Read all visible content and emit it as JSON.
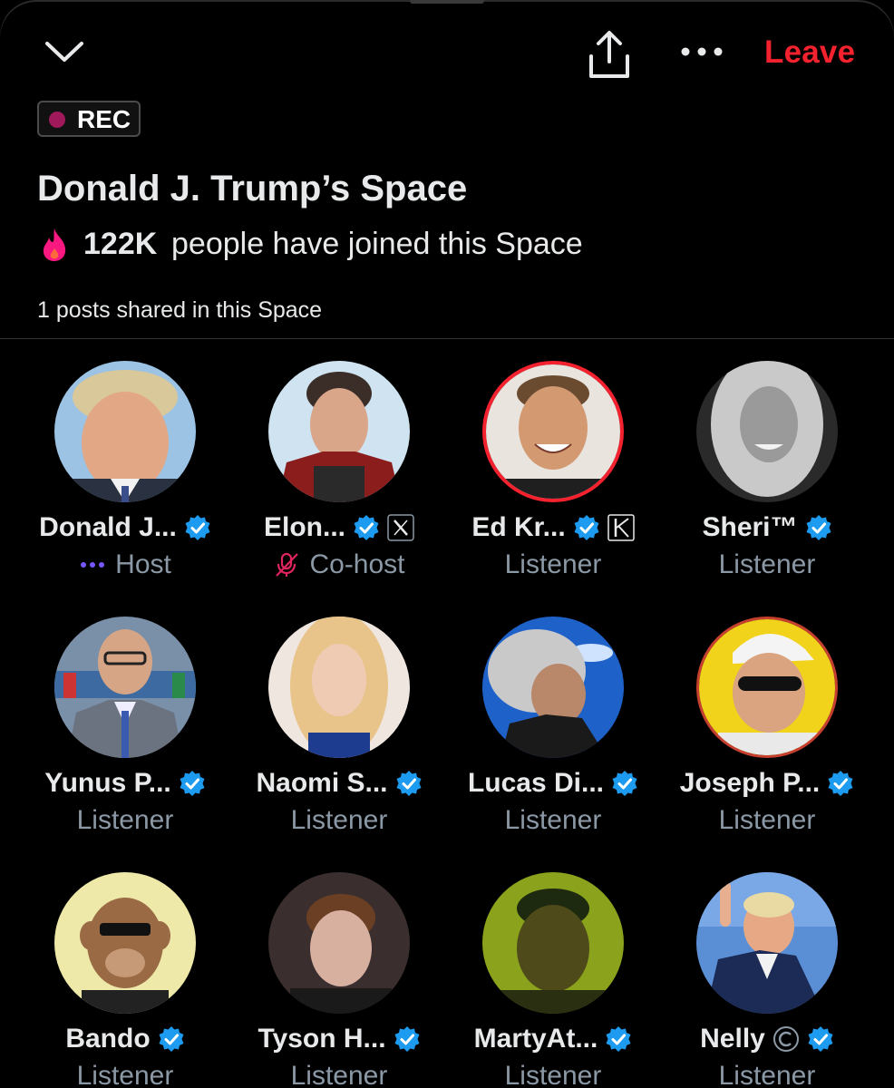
{
  "header": {
    "collapse_icon": "chevron-down-icon",
    "share_icon": "share-icon",
    "more_icon": "more-dots-icon",
    "leave_label": "Leave",
    "leave_color": "#f4212e"
  },
  "recording": {
    "label": "REC",
    "dot_color": "#a0195a"
  },
  "space": {
    "title": "Donald J. Trump’s Space",
    "joined_icon": "flame-icon",
    "joined_count": "122K",
    "joined_text": "people have joined this Space",
    "posts_text": "1 posts shared in this Space"
  },
  "participants": [
    {
      "name": "Donald J...",
      "role": "Host",
      "verified": true,
      "status_icon": "speaking-dots-icon"
    },
    {
      "name": "Elon...",
      "role": "Co-host",
      "verified": true,
      "affiliation": "x-logo-icon",
      "status_icon": "mic-muted-icon"
    },
    {
      "name": "Ed Kr...",
      "role": "Listener",
      "verified": true,
      "affiliation": "k-logo-icon",
      "speaking": true
    },
    {
      "name": "Sheri™",
      "role": "Listener",
      "verified": true
    },
    {
      "name": "Yunus P...",
      "role": "Listener",
      "verified": true
    },
    {
      "name": "Naomi S...",
      "role": "Listener",
      "verified": true
    },
    {
      "name": "Lucas Di...",
      "role": "Listener",
      "verified": true
    },
    {
      "name": "Joseph P...",
      "role": "Listener",
      "verified": true,
      "speaking": true
    },
    {
      "name": "Bando",
      "role": "Listener",
      "verified": true
    },
    {
      "name": "Tyson H...",
      "role": "Listener",
      "verified": true
    },
    {
      "name": "MartyAt...",
      "role": "Listener",
      "verified": true
    },
    {
      "name": "Nelly",
      "role": "Listener",
      "verified": true,
      "affiliation": "c-circle-icon"
    }
  ],
  "colors": {
    "verified": "#1d9bf0",
    "role_text": "#8b98a5",
    "accent_purple": "#7856ff",
    "muted_pink": "#e0245e"
  }
}
